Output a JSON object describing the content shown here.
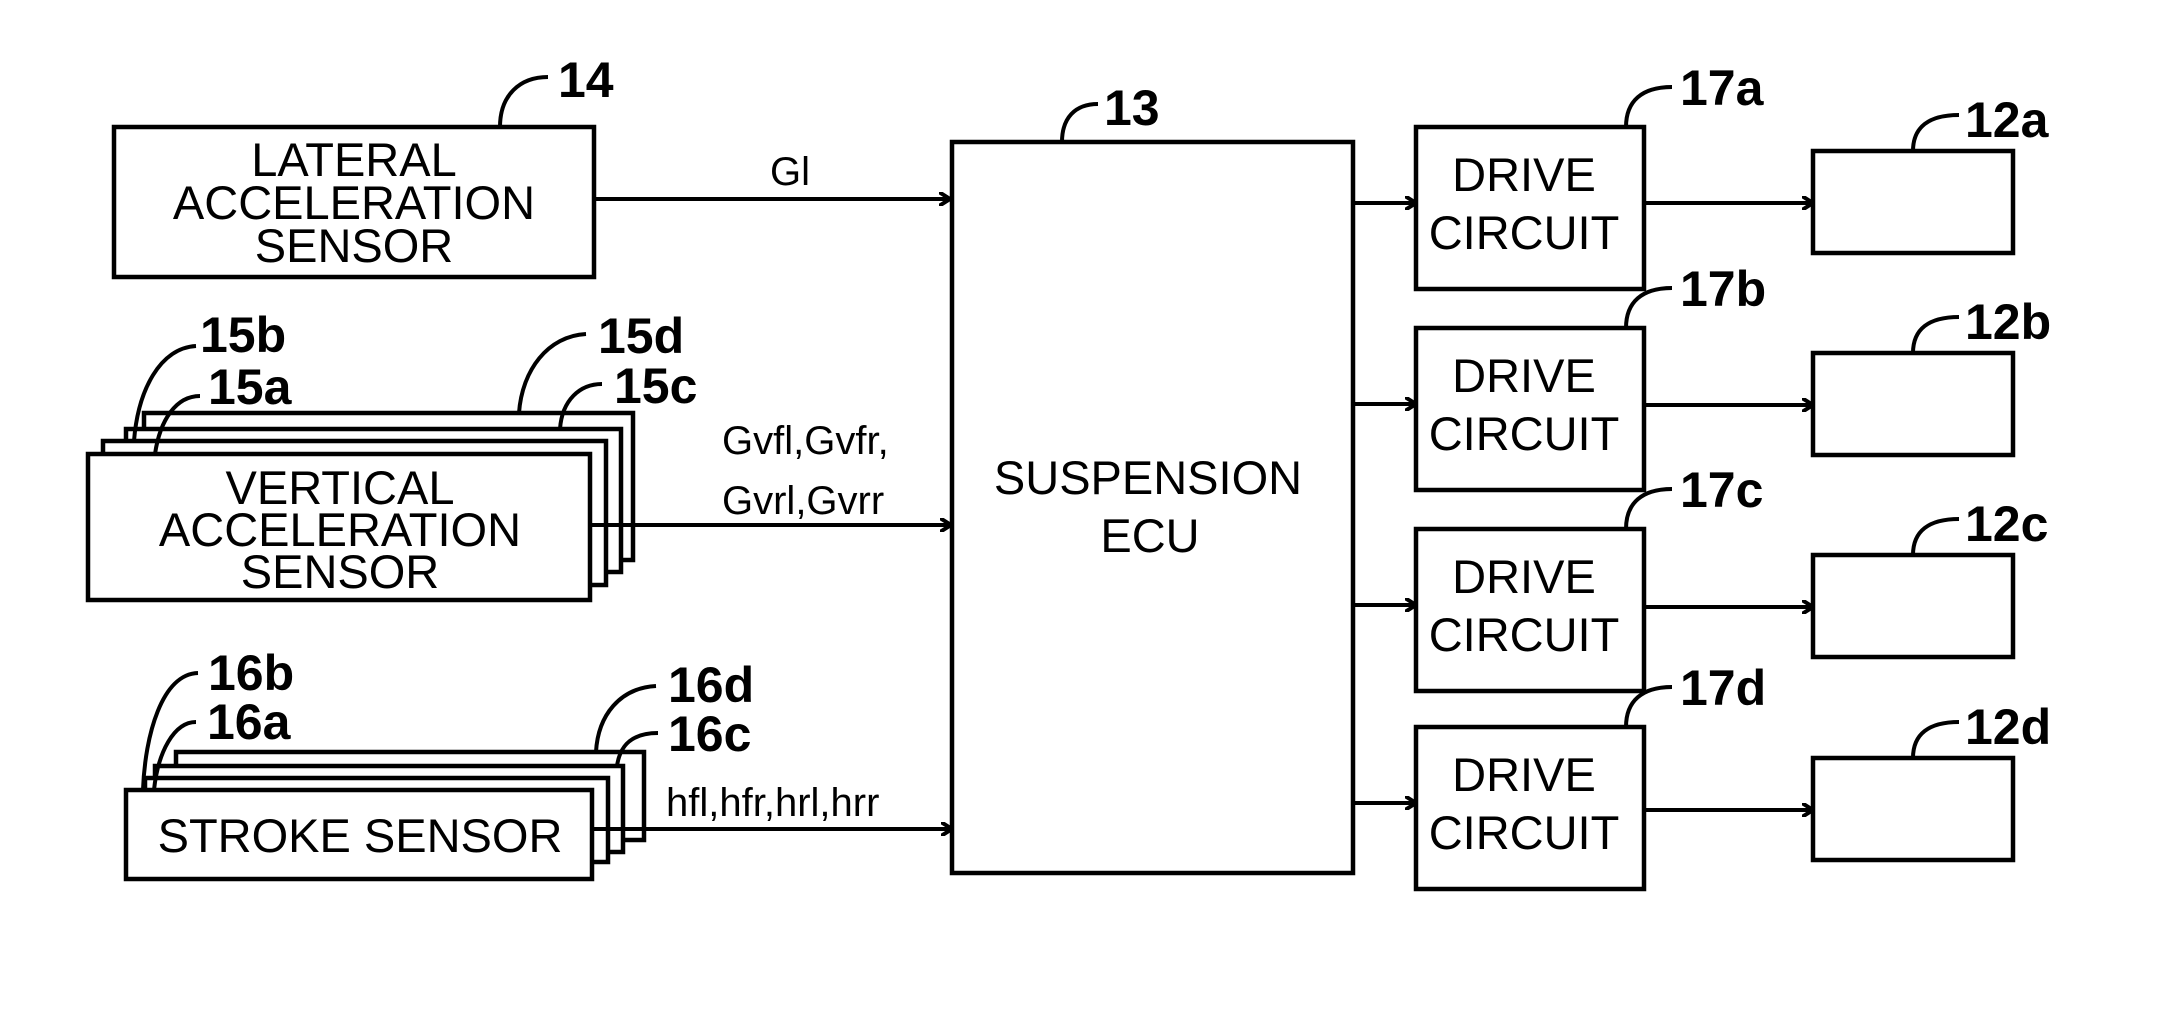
{
  "diagram": {
    "type": "block-diagram",
    "description": "Suspension control system block diagram",
    "colors": {
      "line": "#000000",
      "background": "#ffffff"
    },
    "sensors": {
      "lateral": {
        "ref": "14",
        "lines": [
          "LATERAL",
          "ACCELERATION",
          "SENSOR"
        ],
        "signal": "Gl"
      },
      "vertical": {
        "refs": [
          "15a",
          "15b",
          "15c",
          "15d"
        ],
        "lines": [
          "VERTICAL",
          "ACCELERATION",
          "SENSOR"
        ],
        "signal_lines": [
          "Gvfl,Gvfr,",
          "Gvrl,Gvrr"
        ]
      },
      "stroke": {
        "refs": [
          "16a",
          "16b",
          "16c",
          "16d"
        ],
        "lines": [
          "STROKE SENSOR"
        ],
        "signal": "hfl,hfr,hrl,hrr"
      }
    },
    "ecu": {
      "ref": "13",
      "lines": [
        "SUSPENSION",
        "ECU"
      ]
    },
    "drive_circuits": [
      {
        "ref": "17a",
        "lines": [
          "DRIVE",
          "CIRCUIT"
        ]
      },
      {
        "ref": "17b",
        "lines": [
          "DRIVE",
          "CIRCUIT"
        ]
      },
      {
        "ref": "17c",
        "lines": [
          "DRIVE",
          "CIRCUIT"
        ]
      },
      {
        "ref": "17d",
        "lines": [
          "DRIVE",
          "CIRCUIT"
        ]
      }
    ],
    "actuators": [
      {
        "ref": "12a"
      },
      {
        "ref": "12b"
      },
      {
        "ref": "12c"
      },
      {
        "ref": "12d"
      }
    ]
  }
}
